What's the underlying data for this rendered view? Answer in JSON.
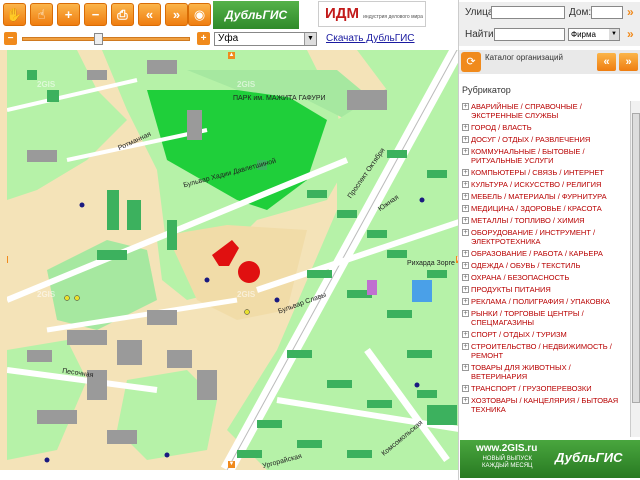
{
  "toolbar": {
    "buttons": [
      {
        "icon": "hand-pan-icon",
        "glyph": "✋"
      },
      {
        "icon": "hand-select-icon",
        "glyph": "☝"
      },
      {
        "icon": "zoom-in-icon",
        "glyph": "+"
      },
      {
        "icon": "zoom-out-icon",
        "glyph": "−"
      },
      {
        "icon": "print-icon",
        "glyph": "⎙"
      },
      {
        "icon": "back-icon",
        "glyph": "«"
      },
      {
        "icon": "forward-icon",
        "glyph": "»"
      },
      {
        "icon": "info-icon",
        "glyph": "◉"
      }
    ],
    "logo_dubl": "ДубльГИС",
    "logo_idm": "ИДМ",
    "logo_idm_sub": "индустрия делового мира"
  },
  "zoom": {
    "minus": "−",
    "plus": "+",
    "level": 0.45
  },
  "city": {
    "selected": "Уфа"
  },
  "download_link": "Скачать ДубльГИС",
  "search": {
    "street_label": "Улица:",
    "house_label": "Дом:",
    "find_label": "Найти:",
    "type_selected": "Фирма",
    "go": "»"
  },
  "catalog": {
    "title": "Каталог организаций",
    "rubricator": "Рубрикатор",
    "items": [
      "АВАРИЙНЫЕ / СПРАВОЧНЫЕ / ЭКСТРЕННЫЕ СЛУЖБЫ",
      "ГОРОД / ВЛАСТЬ",
      "ДОСУГ / ОТДЫХ / РАЗВЛЕЧЕНИЯ",
      "КОММУНАЛЬНЫЕ / БЫТОВЫЕ / РИТУАЛЬНЫЕ УСЛУГИ",
      "КОМПЬЮТЕРЫ / СВЯЗЬ / ИНТЕРНЕТ",
      "КУЛЬТУРА / ИСКУССТВО / РЕЛИГИЯ",
      "МЕБЕЛЬ / МАТЕРИАЛЫ / ФУРНИТУРА",
      "МЕДИЦИНА / ЗДОРОВЬЕ / КРАСОТА",
      "МЕТАЛЛЫ / ТОПЛИВО / ХИМИЯ",
      "ОБОРУДОВАНИЕ / ИНСТРУМЕНТ / ЭЛЕКТРОТЕХНИКА",
      "ОБРАЗОВАНИЕ / РАБОТА / КАРЬЕРА",
      "ОДЕЖДА / ОБУВЬ / ТЕКСТИЛЬ",
      "ОХРАНА / БЕЗОПАСНОСТЬ",
      "ПРОДУКТЫ ПИТАНИЯ",
      "РЕКЛАМА / ПОЛИГРАФИЯ / УПАКОВКА",
      "РЫНКИ / ТОРГОВЫЕ ЦЕНТРЫ / СПЕЦМАГАЗИНЫ",
      "СПОРТ / ОТДЫХ / ТУРИЗМ",
      "СТРОИТЕЛЬСТВО / НЕДВИЖИМОСТЬ / РЕМОНТ",
      "ТОВАРЫ ДЛЯ ЖИВОТНЫХ / ВЕТЕРИНАРИЯ",
      "ТРАНСПОРТ / ГРУЗОПЕРЕВОЗКИ",
      "ХОЗТОВАРЫ / КАНЦЕЛЯРИЯ / БЫТОВАЯ ТЕХНИКА"
    ]
  },
  "banner": {
    "site": "www.2GIS.ru",
    "line1": "НОВЫЙ ВЫПУСК",
    "line2": "КАЖДЫЙ МЕСЯЦ",
    "brand": "ДубльГИС"
  },
  "map": {
    "labels": [
      "ПАРК им. МАЖИТА ГАФУРИ",
      "Проспект Октября",
      "Бульвар Славы",
      "Бульвар Хадии Давлетшиной",
      "Песочная",
      "Комсомольская",
      "Ургорайская",
      "Ротманная",
      "Южная",
      "Рихарда Зорге"
    ],
    "watermark": "2GIS"
  }
}
